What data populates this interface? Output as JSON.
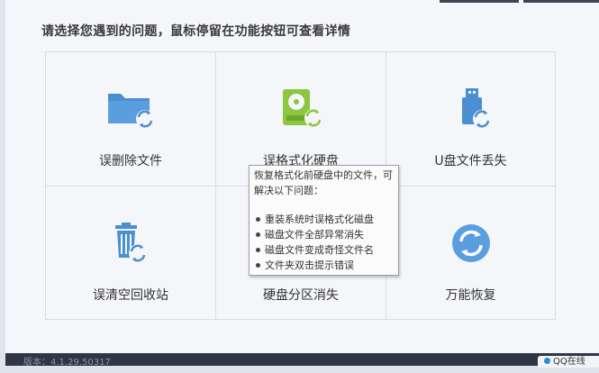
{
  "instruction": "请选择您遇到的问题，鼠标停留在功能按钮可查看详情",
  "options": [
    {
      "label": "误删除文件",
      "icon": "folder-recover-icon"
    },
    {
      "label": "误格式化硬盘",
      "icon": "harddisk-recover-icon"
    },
    {
      "label": "U盘文件丢失",
      "icon": "usb-recover-icon"
    },
    {
      "label": "误清空回收站",
      "icon": "recycle-bin-recover-icon"
    },
    {
      "label": "硬盘分区消失",
      "icon": "partition-recover-icon"
    },
    {
      "label": "万能恢复",
      "icon": "universal-recover-icon"
    }
  ],
  "tooltip": {
    "description": "恢复格式化前硬盘中的文件，可解决以下问题：",
    "items": [
      "重装系统时误格式化磁盘",
      "磁盘文件全部异常消失",
      "磁盘文件变成奇怪文件名",
      "文件夹双击提示错误"
    ]
  },
  "status": {
    "version": "版本：4.1.29.50317",
    "online": "QQ在线"
  },
  "colors": {
    "icon_blue": "#4a8fd0",
    "icon_green": "#8dc63f",
    "panel_bg": "#f4f6fa",
    "statusbar": "#2f3645"
  }
}
